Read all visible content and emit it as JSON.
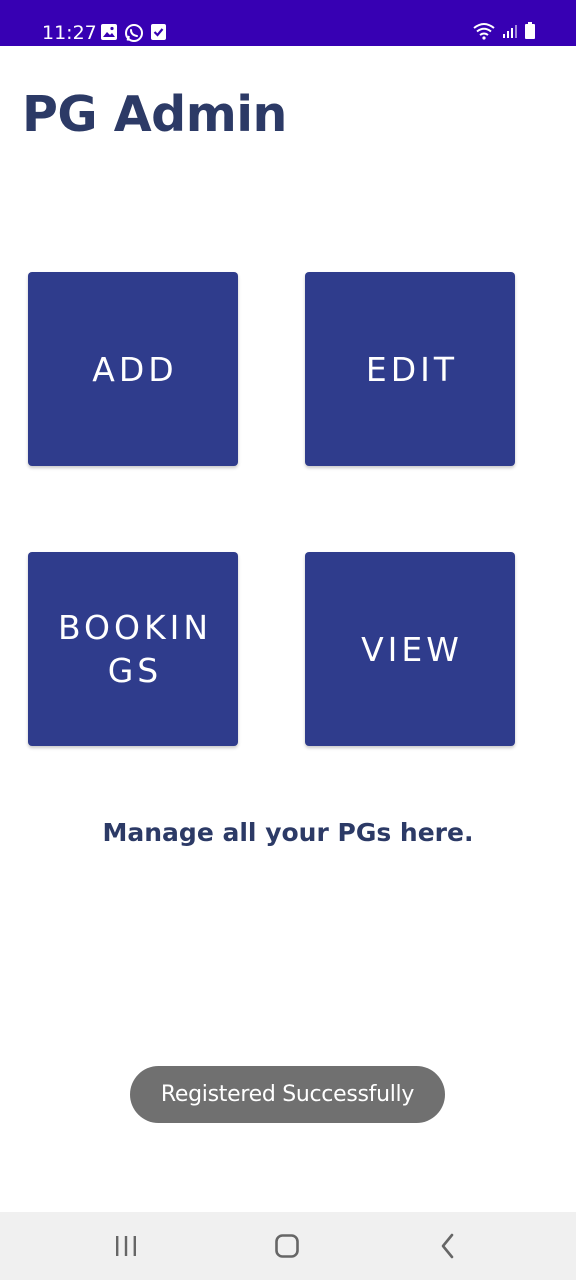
{
  "status_bar": {
    "time": "11:27",
    "left_icons": [
      "gallery-icon",
      "whatsapp-icon",
      "task-check-icon"
    ],
    "right_icons": [
      "wifi-icon",
      "cellular-signal-icon",
      "battery-icon"
    ],
    "background_color": "#3700b3"
  },
  "header": {
    "title": "PG Admin"
  },
  "tiles": [
    {
      "label": "ADD"
    },
    {
      "label": "EDIT"
    },
    {
      "label": "BOOKINGS"
    },
    {
      "label": "VIEW"
    }
  ],
  "tagline": "Manage all your PGs here.",
  "toast": {
    "message": "Registered Successfully"
  },
  "navigation_bar": {
    "buttons": [
      "recent-apps-icon",
      "home-icon",
      "back-icon"
    ]
  },
  "colors": {
    "tile_background": "#2f3c8c",
    "title_text": "#2c3a66",
    "toast_background": "#707070"
  }
}
